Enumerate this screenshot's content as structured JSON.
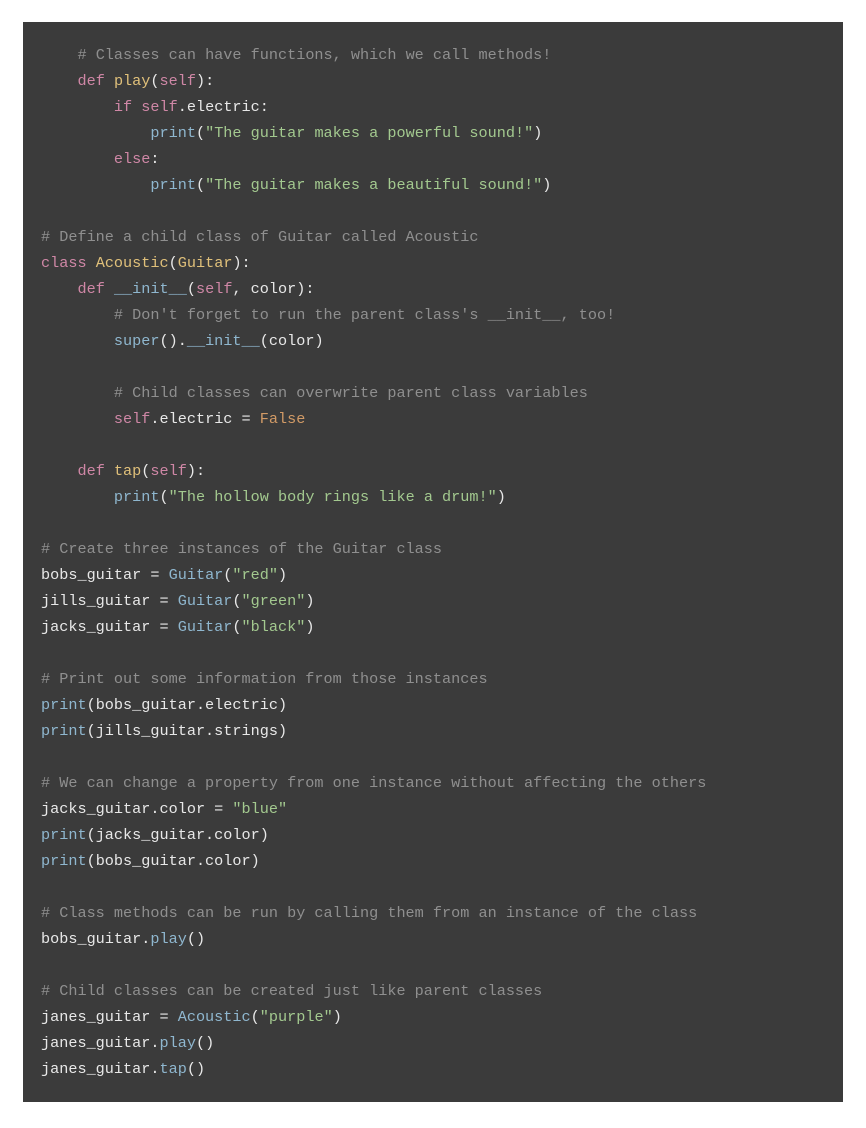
{
  "code": {
    "lines": [
      [
        [
          "    ",
          "id"
        ],
        [
          "# Classes can have functions, which we call methods!",
          "cmt"
        ]
      ],
      [
        [
          "    ",
          "id"
        ],
        [
          "def",
          "kw"
        ],
        [
          " ",
          "id"
        ],
        [
          "play",
          "def"
        ],
        [
          "(",
          "id"
        ],
        [
          "self",
          "self"
        ],
        [
          "):",
          "id"
        ]
      ],
      [
        [
          "        ",
          "id"
        ],
        [
          "if",
          "kw"
        ],
        [
          " ",
          "id"
        ],
        [
          "self",
          "self"
        ],
        [
          ".electric:",
          "id"
        ]
      ],
      [
        [
          "            ",
          "id"
        ],
        [
          "print",
          "call"
        ],
        [
          "(",
          "id"
        ],
        [
          "\"The guitar makes a powerful sound!\"",
          "str"
        ],
        [
          ")",
          "id"
        ]
      ],
      [
        [
          "        ",
          "id"
        ],
        [
          "else",
          "kw"
        ],
        [
          ":",
          "id"
        ]
      ],
      [
        [
          "            ",
          "id"
        ],
        [
          "print",
          "call"
        ],
        [
          "(",
          "id"
        ],
        [
          "\"The guitar makes a beautiful sound!\"",
          "str"
        ],
        [
          ")",
          "id"
        ]
      ],
      [],
      [
        [
          "# Define a child class of Guitar called Acoustic",
          "cmt"
        ]
      ],
      [
        [
          "class",
          "kw"
        ],
        [
          " ",
          "id"
        ],
        [
          "Acoustic",
          "def"
        ],
        [
          "(",
          "id"
        ],
        [
          "Guitar",
          "def"
        ],
        [
          "):",
          "id"
        ]
      ],
      [
        [
          "    ",
          "id"
        ],
        [
          "def",
          "kw"
        ],
        [
          " ",
          "id"
        ],
        [
          "__init__",
          "call"
        ],
        [
          "(",
          "id"
        ],
        [
          "self",
          "self"
        ],
        [
          ", color):",
          "id"
        ]
      ],
      [
        [
          "        ",
          "id"
        ],
        [
          "# Don't forget to run the parent class's __init__, too!",
          "cmt"
        ]
      ],
      [
        [
          "        ",
          "id"
        ],
        [
          "super",
          "call"
        ],
        [
          "().",
          "id"
        ],
        [
          "__init__",
          "call"
        ],
        [
          "(color)",
          "id"
        ]
      ],
      [],
      [
        [
          "        ",
          "id"
        ],
        [
          "# Child classes can overwrite parent class variables",
          "cmt"
        ]
      ],
      [
        [
          "        ",
          "id"
        ],
        [
          "self",
          "self"
        ],
        [
          ".electric = ",
          "id"
        ],
        [
          "False",
          "bool"
        ]
      ],
      [],
      [
        [
          "    ",
          "id"
        ],
        [
          "def",
          "kw"
        ],
        [
          " ",
          "id"
        ],
        [
          "tap",
          "def"
        ],
        [
          "(",
          "id"
        ],
        [
          "self",
          "self"
        ],
        [
          "):",
          "id"
        ]
      ],
      [
        [
          "        ",
          "id"
        ],
        [
          "print",
          "call"
        ],
        [
          "(",
          "id"
        ],
        [
          "\"The hollow body rings like a drum!\"",
          "str"
        ],
        [
          ")",
          "id"
        ]
      ],
      [],
      [
        [
          "# Create three instances of the Guitar class",
          "cmt"
        ]
      ],
      [
        [
          "bobs_guitar = ",
          "id"
        ],
        [
          "Guitar",
          "call"
        ],
        [
          "(",
          "id"
        ],
        [
          "\"red\"",
          "str"
        ],
        [
          ")",
          "id"
        ]
      ],
      [
        [
          "jills_guitar = ",
          "id"
        ],
        [
          "Guitar",
          "call"
        ],
        [
          "(",
          "id"
        ],
        [
          "\"green\"",
          "str"
        ],
        [
          ")",
          "id"
        ]
      ],
      [
        [
          "jacks_guitar = ",
          "id"
        ],
        [
          "Guitar",
          "call"
        ],
        [
          "(",
          "id"
        ],
        [
          "\"black\"",
          "str"
        ],
        [
          ")",
          "id"
        ]
      ],
      [],
      [
        [
          "# Print out some information from those instances",
          "cmt"
        ]
      ],
      [
        [
          "print",
          "call"
        ],
        [
          "(bobs_guitar.electric)",
          "id"
        ]
      ],
      [
        [
          "print",
          "call"
        ],
        [
          "(jills_guitar.strings)",
          "id"
        ]
      ],
      [],
      [
        [
          "# We can change a property from one instance without affecting the others",
          "cmt"
        ]
      ],
      [
        [
          "jacks_guitar.color = ",
          "id"
        ],
        [
          "\"blue\"",
          "str"
        ]
      ],
      [
        [
          "print",
          "call"
        ],
        [
          "(jacks_guitar.color)",
          "id"
        ]
      ],
      [
        [
          "print",
          "call"
        ],
        [
          "(bobs_guitar.color)",
          "id"
        ]
      ],
      [],
      [
        [
          "# Class methods can be run by calling them from an instance of the class",
          "cmt"
        ]
      ],
      [
        [
          "bobs_guitar.",
          "id"
        ],
        [
          "play",
          "call"
        ],
        [
          "()",
          "id"
        ]
      ],
      [],
      [
        [
          "# Child classes can be created just like parent classes",
          "cmt"
        ]
      ],
      [
        [
          "janes_guitar = ",
          "id"
        ],
        [
          "Acoustic",
          "call"
        ],
        [
          "(",
          "id"
        ],
        [
          "\"purple\"",
          "str"
        ],
        [
          ")",
          "id"
        ]
      ],
      [
        [
          "janes_guitar.",
          "id"
        ],
        [
          "play",
          "call"
        ],
        [
          "()",
          "id"
        ]
      ],
      [
        [
          "janes_guitar.",
          "id"
        ],
        [
          "tap",
          "call"
        ],
        [
          "()",
          "id"
        ]
      ]
    ]
  }
}
